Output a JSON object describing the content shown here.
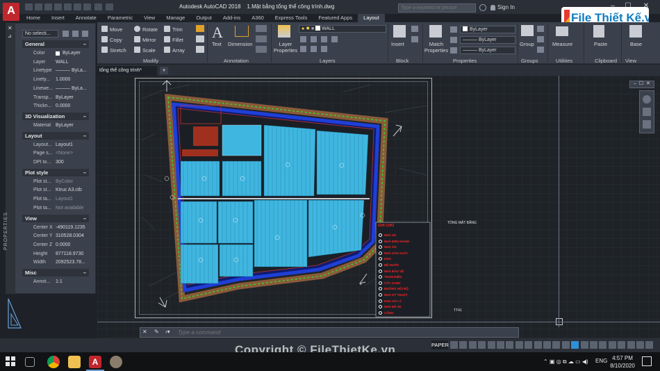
{
  "app": {
    "title": "Autodesk AutoCAD 2018",
    "file": "1.Mặt bằng tổng thể công trình.dwg",
    "search_placeholder": "Type a keyword or phrase",
    "signin": "Sign In"
  },
  "tabs": [
    "Home",
    "Insert",
    "Annotate",
    "Parametric",
    "View",
    "Manage",
    "Output",
    "Add-ins",
    "A360",
    "Express Tools",
    "Featured Apps",
    "Layout"
  ],
  "active_tab": "Layout",
  "ribbon": {
    "modify": {
      "tools": [
        "Move",
        "Rotate",
        "Trim",
        "Copy",
        "Mirror",
        "Fillet",
        "Stretch",
        "Scale",
        "Array"
      ],
      "label": "Modify"
    },
    "annotation": {
      "text": "Text",
      "dimension": "Dimension",
      "label": "Annotation"
    },
    "layers": {
      "layer_properties": "Layer Properties",
      "current_layer": "WALL",
      "label": "Layers"
    },
    "block": {
      "insert": "Insert",
      "label": "Block"
    },
    "properties": {
      "match": "Match Properties",
      "color": "ByLayer",
      "linetype": "ByLayer",
      "lineweight": "ByLayer",
      "label": "Properties"
    },
    "groups": {
      "group": "Group",
      "label": "Groups"
    },
    "utilities": {
      "measure": "Measure",
      "label": "Utilities"
    },
    "clipboard": {
      "paste": "Paste",
      "label": "Clipboard"
    },
    "view": {
      "base": "Base",
      "label": "View"
    }
  },
  "palette": {
    "selection": "No selecti...",
    "title": "PROPERTIES",
    "general": {
      "header": "General",
      "rows": [
        {
          "k": "Color",
          "v": "ByLayer"
        },
        {
          "k": "Layer",
          "v": "WALL"
        },
        {
          "k": "Linetype",
          "v": "——— ByLa..."
        },
        {
          "k": "Linety...",
          "v": "1.0000"
        },
        {
          "k": "Linewe...",
          "v": "——— ByLa..."
        },
        {
          "k": "Transp...",
          "v": "ByLayer"
        },
        {
          "k": "Thickn...",
          "v": "0.0000"
        }
      ]
    },
    "viz": {
      "header": "3D Visualization",
      "rows": [
        {
          "k": "Material",
          "v": "ByLayer"
        }
      ]
    },
    "layout": {
      "header": "Layout",
      "rows": [
        {
          "k": "Layout...",
          "v": "Layout1"
        },
        {
          "k": "Page s...",
          "v": "<None>"
        },
        {
          "k": "DPI to...",
          "v": "300"
        }
      ]
    },
    "plot": {
      "header": "Plot style",
      "rows": [
        {
          "k": "Plot st...",
          "v": "ByColor"
        },
        {
          "k": "Plot st...",
          "v": "Ktruc A3.ctb"
        },
        {
          "k": "Plot ta...",
          "v": "Layout1"
        },
        {
          "k": "Plot ta...",
          "v": "Not available"
        }
      ]
    },
    "view": {
      "header": "View",
      "rows": [
        {
          "k": "Center X",
          "v": "-490119.1235"
        },
        {
          "k": "Center Y",
          "v": "310528.0304"
        },
        {
          "k": "Center Z",
          "v": "0.0000"
        },
        {
          "k": "Height",
          "v": "877118.9730"
        },
        {
          "k": "Width",
          "v": "2092523.78..."
        }
      ]
    },
    "misc": {
      "header": "Misc",
      "rows": [
        {
          "k": "Annot...",
          "v": "1:1"
        }
      ]
    }
  },
  "file_tab": "tổng thể công trình*",
  "drawing": {
    "legend_title": "GHI CHÚ",
    "legend_items": [
      "NHÀ XE",
      "NHÀ ĐIỀU HÀNH",
      "NHÀ ĂN",
      "NHÀ SẢN XUẤT",
      "KHO",
      "BỂ NƯỚC",
      "NHÀ BẢO VỆ",
      "TRẠM ĐIỆN",
      "CÂY XANH",
      "ĐƯỜNG NỘI BỘ",
      "NHÀ KỸ THUẬT",
      "KHU XỬ LÝ",
      "NHÀ ĐỂ XE",
      "CỔNG"
    ],
    "label_right": "TỔNG MẶT BẰNG",
    "label_tt": "TT41"
  },
  "command": {
    "placeholder": "Type a command"
  },
  "status": {
    "paper": "PAPER"
  },
  "taskbar": {
    "lang": "ENG",
    "time": "4:57 PM",
    "date": "8/10/2020"
  },
  "logo": {
    "text": "File Thiết Kế.vn"
  },
  "watermark": "Copyright © FileThietKe.vn",
  "colors": {
    "autocad_red": "#c0272d",
    "building": "#3fb6e0",
    "road": "#1f3fd8",
    "tree": "#32d62c"
  }
}
